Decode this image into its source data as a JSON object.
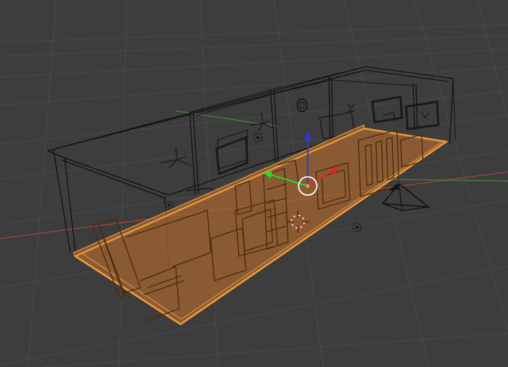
{
  "viewport": {
    "mode": "wireframe",
    "background_color": "#3d3d3d",
    "grid_color": "#4a4a4a",
    "selection_color": "#f29a3a",
    "selection_fill": "#a8662e",
    "axis_x_color": "#c84040",
    "axis_y_color": "#4a9a38",
    "gizmo_x_color": "#d82a2a",
    "gizmo_y_color": "#2ad82a",
    "gizmo_z_color": "#2a3ad8",
    "icons": [
      "3d-cursor-icon",
      "manipulator-gizmo-icon",
      "camera-object-icon",
      "lamp-object-icon"
    ]
  }
}
